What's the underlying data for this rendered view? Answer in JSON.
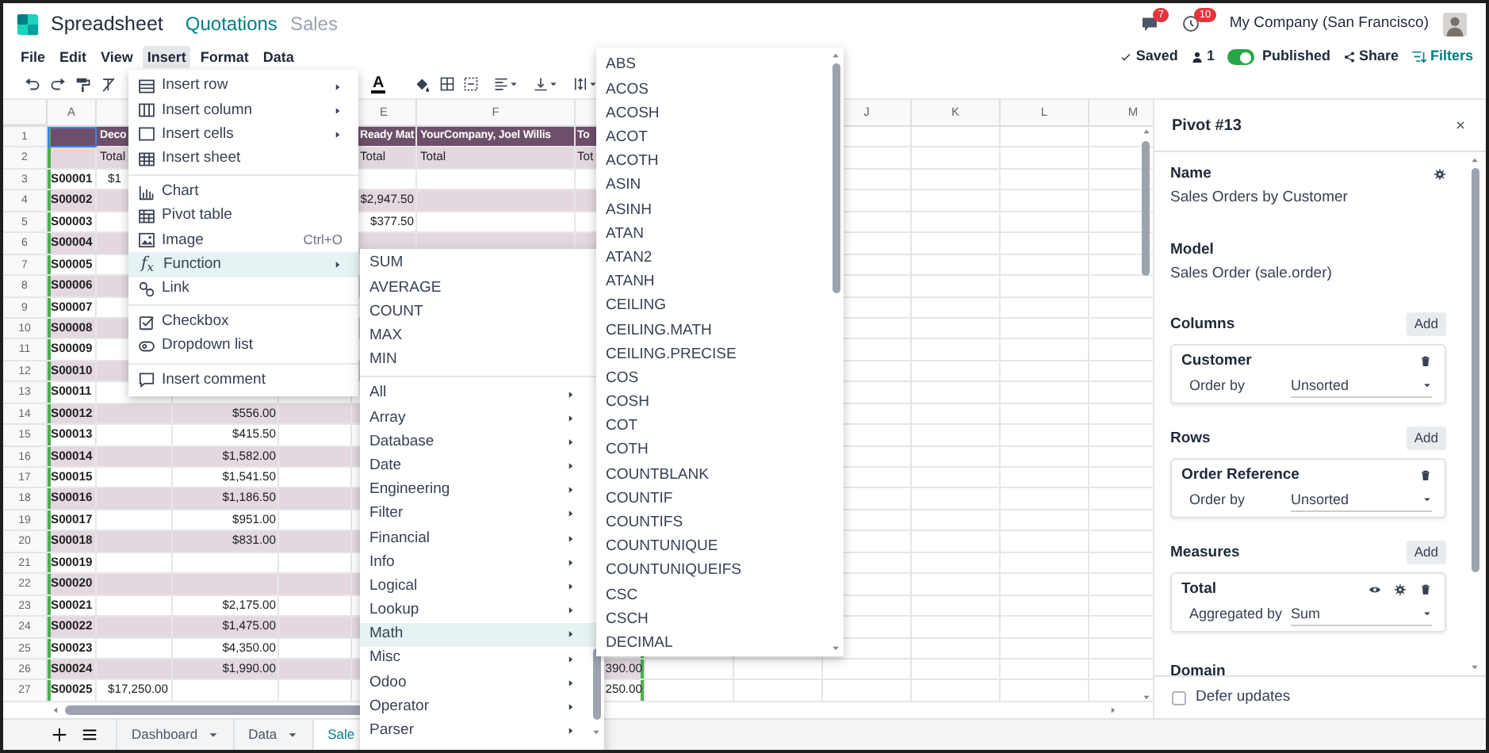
{
  "topbar": {
    "app_name": "Spreadsheet",
    "breadcrumbs": [
      {
        "label": "Quotations",
        "current": false
      },
      {
        "label": "Sales",
        "current": true
      }
    ],
    "messages_badge": "7",
    "activity_badge": "10",
    "company": "My Company (San Francisco)"
  },
  "menubar": [
    {
      "label": "File",
      "selected": false
    },
    {
      "label": "Edit",
      "selected": false
    },
    {
      "label": "View",
      "selected": false
    },
    {
      "label": "Insert",
      "selected": true
    },
    {
      "label": "Format",
      "selected": false
    },
    {
      "label": "Data",
      "selected": false
    }
  ],
  "status": {
    "saved": "Saved",
    "collaborators": "1",
    "published": {
      "label": "Published",
      "on": true
    },
    "share": "Share",
    "filters": "Filters"
  },
  "toolbar": {
    "text_color_label": "A"
  },
  "grid": {
    "columns": [
      {
        "header": "A"
      },
      {},
      {},
      {},
      {
        "header": "E"
      },
      {
        "header": "F"
      },
      {},
      {},
      {},
      {
        "header": "J"
      },
      {
        "header": "K"
      },
      {
        "header": "L"
      },
      {
        "header": "M"
      }
    ],
    "rows": [
      {
        "number": "1",
        "kind": "header",
        "cells": {
          "b": "Deco",
          "e": "Ready Mat",
          "f": "YourCompany, Joel Willis",
          "g": "To"
        }
      },
      {
        "number": "2",
        "kind": "subheader",
        "cells": {
          "b": "Total",
          "e": "Total",
          "f": "Total",
          "g": "Tot"
        }
      },
      {
        "number": "3",
        "kind": "data",
        "shaded": false,
        "cells": {
          "a": "S00001",
          "b": "$1"
        }
      },
      {
        "number": "4",
        "kind": "data",
        "shaded": true,
        "cells": {
          "a": "S00002",
          "e": "$2,947.50"
        }
      },
      {
        "number": "5",
        "kind": "data",
        "shaded": false,
        "cells": {
          "a": "S00003",
          "e": "$377.50"
        }
      },
      {
        "number": "6",
        "kind": "data",
        "shaded": true,
        "cells": {
          "a": "S00004"
        }
      },
      {
        "number": "7",
        "kind": "data",
        "shaded": false,
        "cells": {
          "a": "S00005"
        }
      },
      {
        "number": "8",
        "kind": "data",
        "shaded": true,
        "cells": {
          "a": "S00006"
        }
      },
      {
        "number": "9",
        "kind": "data",
        "shaded": false,
        "cells": {
          "a": "S00007"
        }
      },
      {
        "number": "10",
        "kind": "data",
        "shaded": true,
        "cells": {
          "a": "S00008"
        }
      },
      {
        "number": "11",
        "kind": "data",
        "shaded": false,
        "cells": {
          "a": "S00009"
        }
      },
      {
        "number": "12",
        "kind": "data",
        "shaded": true,
        "cells": {
          "a": "S00010"
        }
      },
      {
        "number": "13",
        "kind": "data",
        "shaded": false,
        "cells": {
          "a": "S00011"
        }
      },
      {
        "number": "14",
        "kind": "data",
        "shaded": true,
        "cells": {
          "a": "S00012",
          "c": "$556.00"
        }
      },
      {
        "number": "15",
        "kind": "data",
        "shaded": false,
        "cells": {
          "a": "S00013",
          "c": "$415.50"
        }
      },
      {
        "number": "16",
        "kind": "data",
        "shaded": true,
        "cells": {
          "a": "S00014",
          "c": "$1,582.00"
        }
      },
      {
        "number": "17",
        "kind": "data",
        "shaded": false,
        "cells": {
          "a": "S00015",
          "c": "$1,541.50"
        }
      },
      {
        "number": "18",
        "kind": "data",
        "shaded": true,
        "cells": {
          "a": "S00016",
          "c": "$1,186.50"
        }
      },
      {
        "number": "19",
        "kind": "data",
        "shaded": false,
        "cells": {
          "a": "S00017",
          "c": "$951.00"
        }
      },
      {
        "number": "20",
        "kind": "data",
        "shaded": true,
        "cells": {
          "a": "S00018",
          "c": "$831.00"
        }
      },
      {
        "number": "21",
        "kind": "data",
        "shaded": false,
        "cells": {
          "a": "S00019"
        }
      },
      {
        "number": "22",
        "kind": "data",
        "shaded": true,
        "cells": {
          "a": "S00020"
        }
      },
      {
        "number": "23",
        "kind": "data",
        "shaded": false,
        "cells": {
          "a": "S00021",
          "c": "$2,175.00"
        }
      },
      {
        "number": "24",
        "kind": "data",
        "shaded": true,
        "cells": {
          "a": "S00022",
          "c": "$1,475.00"
        }
      },
      {
        "number": "25",
        "kind": "data",
        "shaded": false,
        "cells": {
          "a": "S00023",
          "c": "$4,350.00"
        }
      },
      {
        "number": "26",
        "kind": "data",
        "shaded": true,
        "cells": {
          "a": "S00024",
          "c": "$1,990.00",
          "g": "390.00"
        }
      },
      {
        "number": "27",
        "kind": "data",
        "shaded": false,
        "cells": {
          "a": "S00025",
          "b": "$17,250.00",
          "g": "250.00"
        }
      }
    ]
  },
  "insert_menu": {
    "items": [
      {
        "kind": "item",
        "label": "Insert row",
        "submenu": true,
        "selected": false
      },
      {
        "kind": "item",
        "label": "Insert column",
        "submenu": true,
        "selected": false
      },
      {
        "kind": "item",
        "label": "Insert cells",
        "submenu": true,
        "selected": false
      },
      {
        "kind": "item",
        "label": "Insert sheet",
        "submenu": false,
        "selected": false
      },
      {
        "kind": "divider"
      },
      {
        "kind": "item",
        "label": "Chart",
        "submenu": false,
        "selected": false
      },
      {
        "kind": "item",
        "label": "Pivot table",
        "submenu": false,
        "selected": false
      },
      {
        "kind": "item",
        "label": "Image",
        "shortcut": "Ctrl+O",
        "submenu": false,
        "selected": false
      },
      {
        "kind": "item",
        "icon_text": "f$_{x}$",
        "label": "Function",
        "submenu": true,
        "selected": true
      },
      {
        "kind": "item",
        "label": "Link",
        "submenu": false,
        "selected": false
      },
      {
        "kind": "divider"
      },
      {
        "kind": "item",
        "label": "Checkbox",
        "submenu": false,
        "selected": false
      },
      {
        "kind": "item",
        "label": "Dropdown list",
        "submenu": false,
        "selected": false
      },
      {
        "kind": "divider"
      },
      {
        "kind": "item",
        "label": "Insert comment",
        "submenu": false,
        "selected": false
      }
    ]
  },
  "function_menu": {
    "items": [
      {
        "kind": "item",
        "label": "SUM",
        "submenu": false,
        "selected": false
      },
      {
        "kind": "item",
        "label": "AVERAGE",
        "submenu": false,
        "selected": false
      },
      {
        "kind": "item",
        "label": "COUNT",
        "submenu": false,
        "selected": false
      },
      {
        "kind": "item",
        "label": "MAX",
        "submenu": false,
        "selected": false
      },
      {
        "kind": "item",
        "label": "MIN",
        "submenu": false,
        "selected": false
      },
      {
        "kind": "divider"
      },
      {
        "kind": "item",
        "label": "All",
        "submenu": true,
        "selected": false
      },
      {
        "kind": "item",
        "label": "Array",
        "submenu": true,
        "selected": false
      },
      {
        "kind": "item",
        "label": "Database",
        "submenu": true,
        "selected": false
      },
      {
        "kind": "item",
        "label": "Date",
        "submenu": true,
        "selected": false
      },
      {
        "kind": "item",
        "label": "Engineering",
        "submenu": true,
        "selected": false
      },
      {
        "kind": "item",
        "label": "Filter",
        "submenu": true,
        "selected": false
      },
      {
        "kind": "item",
        "label": "Financial",
        "submenu": true,
        "selected": false
      },
      {
        "kind": "item",
        "label": "Info",
        "submenu": true,
        "selected": false
      },
      {
        "kind": "item",
        "label": "Logical",
        "submenu": true,
        "selected": false
      },
      {
        "kind": "item",
        "label": "Lookup",
        "submenu": true,
        "selected": false
      },
      {
        "kind": "item",
        "label": "Math",
        "submenu": true,
        "selected": true
      },
      {
        "kind": "item",
        "label": "Misc",
        "submenu": true,
        "selected": false
      },
      {
        "kind": "item",
        "label": "Odoo",
        "submenu": true,
        "selected": false
      },
      {
        "kind": "item",
        "label": "Operator",
        "submenu": true,
        "selected": false
      },
      {
        "kind": "item",
        "label": "Parser",
        "submenu": true,
        "selected": false
      }
    ]
  },
  "math_menu": {
    "items": [
      "ABS",
      "ACOS",
      "ACOSH",
      "ACOT",
      "ACOTH",
      "ASIN",
      "ASINH",
      "ATAN",
      "ATAN2",
      "ATANH",
      "CEILING",
      "CEILING.MATH",
      "CEILING.PRECISE",
      "COS",
      "COSH",
      "COT",
      "COTH",
      "COUNTBLANK",
      "COUNTIF",
      "COUNTIFS",
      "COUNTUNIQUE",
      "COUNTUNIQUEIFS",
      "CSC",
      "CSCH",
      "DECIMAL"
    ]
  },
  "pivot_panel": {
    "title": "Pivot #13",
    "sections": [
      {
        "kind": "field",
        "label": "Name",
        "value": "Sales Orders by Customer"
      },
      {
        "kind": "field",
        "label": "Model",
        "value": "Sales Order (sale.order)"
      },
      {
        "kind": "group",
        "label": "Columns",
        "button": "Add",
        "cards": [
          {
            "title": "Customer",
            "option_label": "Order by",
            "option_value": "Unsorted"
          }
        ]
      },
      {
        "kind": "group",
        "label": "Rows",
        "button": "Add",
        "cards": [
          {
            "title": "Order Reference",
            "option_label": "Order by",
            "option_value": "Unsorted"
          }
        ]
      },
      {
        "kind": "group",
        "label": "Measures",
        "button": "Add",
        "cards": [
          {
            "title": "Total",
            "option_label": "Aggregated by",
            "option_value": "Sum"
          }
        ]
      },
      {
        "kind": "heading",
        "label": "Domain"
      }
    ],
    "footer": {
      "label": "Defer updates",
      "checked": false
    }
  },
  "sheet_tabs": [
    {
      "label": "Dashboard",
      "selected": false,
      "dropdown": true
    },
    {
      "label": "Data",
      "selected": false,
      "dropdown": true
    },
    {
      "label": "Sale",
      "selected": true
    }
  ]
}
